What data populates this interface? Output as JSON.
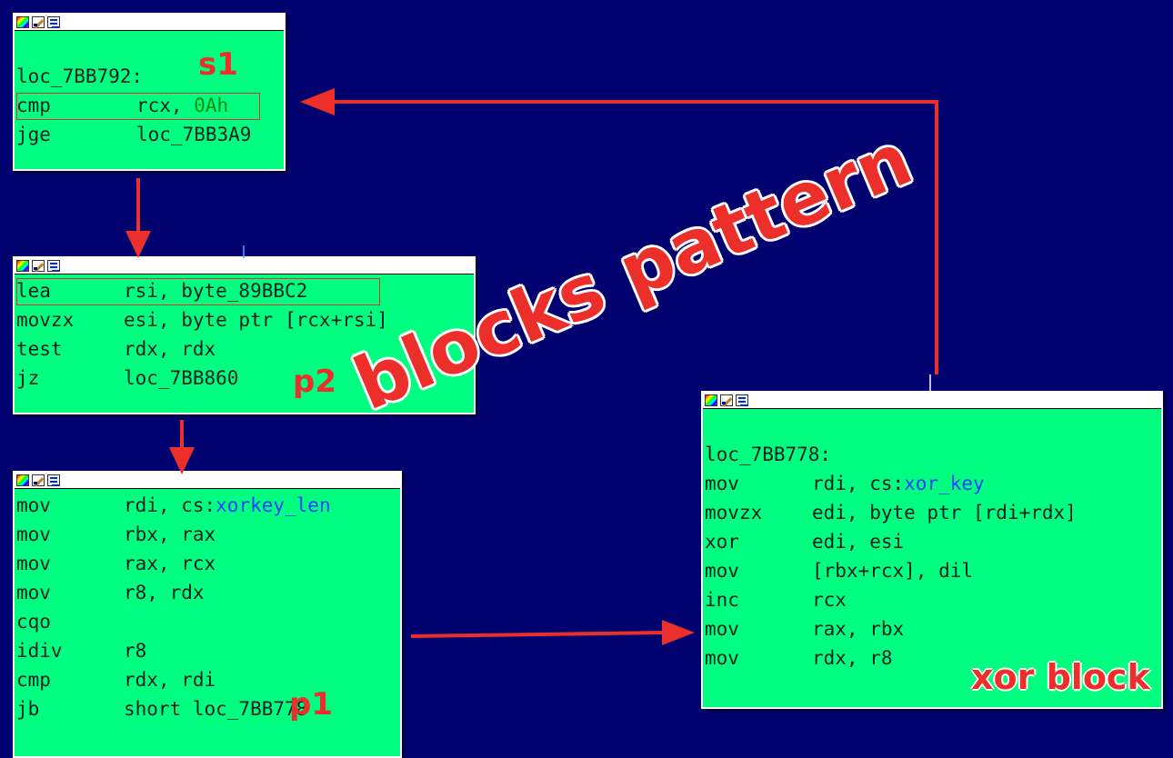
{
  "blocks": {
    "s1": {
      "lines": [
        {
          "mn": "",
          "op": ""
        },
        {
          "mn": "loc_7BB792:",
          "op": ""
        },
        {
          "mn": "cmp",
          "op": "rcx, ",
          "op_hl": "0Ah"
        },
        {
          "mn": "jge",
          "op": "loc_7BB3A9"
        }
      ]
    },
    "p2": {
      "lines": [
        {
          "mn": "lea",
          "op": "rsi, byte_89BBC2"
        },
        {
          "mn": "movzx",
          "op": "esi, byte ptr [rcx+rsi]"
        },
        {
          "mn": "test",
          "op": "rdx, rdx"
        },
        {
          "mn": "jz",
          "op": "loc_7BB860"
        }
      ]
    },
    "p1": {
      "lines": [
        {
          "mn": "mov",
          "op": "rdi, cs:",
          "op_blue": "xorkey_len"
        },
        {
          "mn": "mov",
          "op": "rbx, rax"
        },
        {
          "mn": "mov",
          "op": "rax, rcx"
        },
        {
          "mn": "mov",
          "op": "r8, rdx"
        },
        {
          "mn": "cqo",
          "op": ""
        },
        {
          "mn": "idiv",
          "op": "r8"
        },
        {
          "mn": "cmp",
          "op": "rdx, rdi"
        },
        {
          "mn": "jb",
          "op": "short loc_7BB778"
        }
      ]
    },
    "xor": {
      "lines": [
        {
          "mn": "",
          "op": ""
        },
        {
          "mn": "loc_7BB778:",
          "op": ""
        },
        {
          "mn": "mov",
          "op": "rdi, cs:",
          "op_blue": "xor_key"
        },
        {
          "mn": "movzx",
          "op": "edi, byte ptr [rdi+rdx]"
        },
        {
          "mn": "xor",
          "op": "edi, esi"
        },
        {
          "mn": "mov",
          "op": "[rbx+rcx], dil"
        },
        {
          "mn": "inc",
          "op": "rcx"
        },
        {
          "mn": "mov",
          "op": "rax, rbx"
        },
        {
          "mn": "mov",
          "op": "rdx, r8"
        }
      ]
    }
  },
  "annotations": {
    "s1": "s1",
    "p2": "p2",
    "p1": "p1",
    "xor": "xor block",
    "title": "blocks pattern"
  },
  "colors": {
    "background": "#00006e",
    "node": "#00ff80",
    "annotation": "#ec2f2b",
    "symbol_blue": "#1e40ff",
    "number_green": "#118a11"
  },
  "icons": [
    "color-palette-icon",
    "edit-pencil-icon",
    "graph-view-icon"
  ]
}
